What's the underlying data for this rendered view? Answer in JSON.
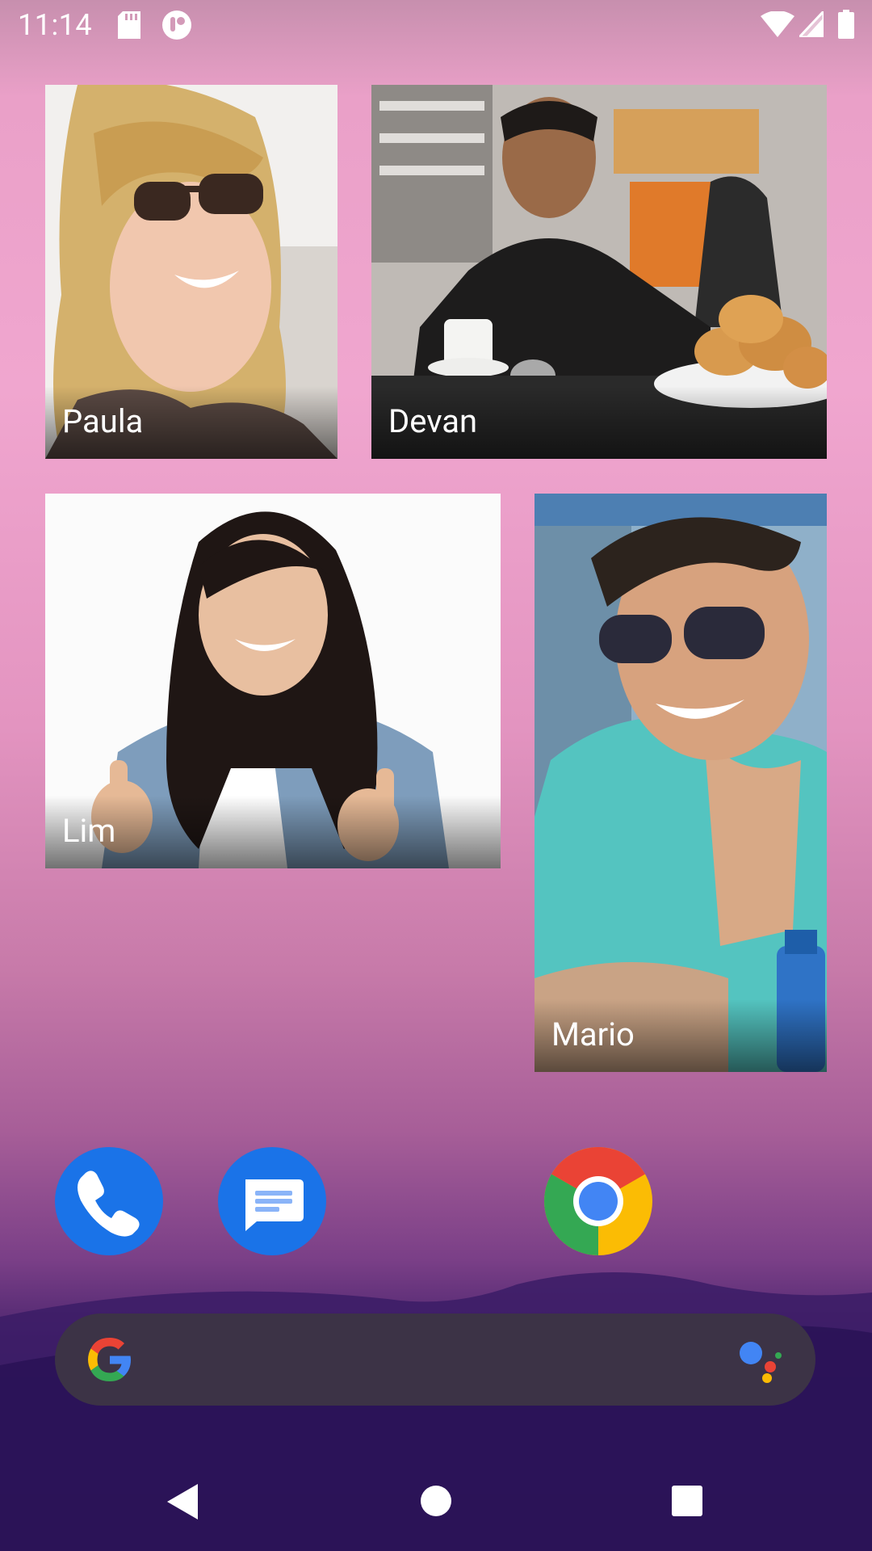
{
  "status_bar": {
    "time": "11:14",
    "left_icons": [
      "sd-card-icon",
      "notification-app-icon"
    ],
    "right_icons": [
      "wifi-icon",
      "cellular-signal-icon",
      "battery-icon"
    ]
  },
  "contacts": [
    {
      "name": "Paula"
    },
    {
      "name": "Devan"
    },
    {
      "name": "Lim"
    },
    {
      "name": "Mario"
    }
  ],
  "dock": [
    "phone-app-icon",
    "messages-app-icon",
    "chrome-app-icon"
  ],
  "search": {
    "icons": [
      "google-g-icon",
      "google-assistant-icon"
    ]
  },
  "nav": [
    "back-button",
    "home-button",
    "recents-button"
  ],
  "colors": {
    "dock_blue": "#1a73e8",
    "search_bg": "#3c3346"
  }
}
